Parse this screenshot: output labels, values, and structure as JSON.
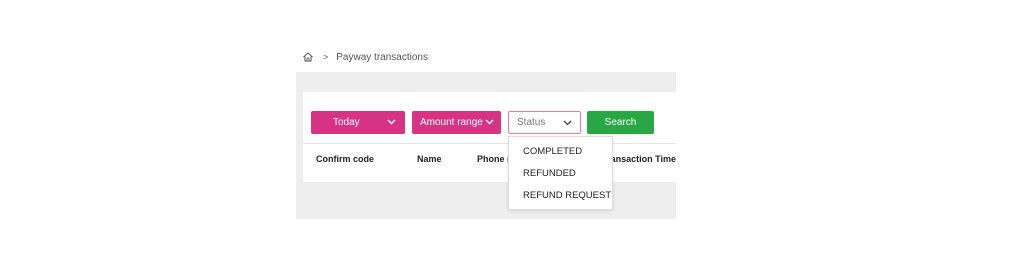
{
  "breadcrumb": {
    "home_icon": "home-icon",
    "separator": ">",
    "current": "Payway transactions"
  },
  "filters": {
    "date": {
      "label": "Today",
      "icon": "chevron-down-icon"
    },
    "amount": {
      "label": "Amount range",
      "icon": "chevron-down-icon"
    },
    "status": {
      "placeholder": "Status",
      "icon": "chevron-down-icon"
    },
    "search_label": "Search"
  },
  "table": {
    "columns": [
      "Confirm code",
      "Name",
      "Phone no",
      "Transaction Time"
    ]
  },
  "status_dropdown": {
    "options": [
      "COMPLETED",
      "REFUNDED",
      "REFUND REQUEST"
    ]
  },
  "colors": {
    "accent_pink": "#d63384",
    "search_green": "#28a745",
    "panel_gray": "#eeeeee"
  }
}
